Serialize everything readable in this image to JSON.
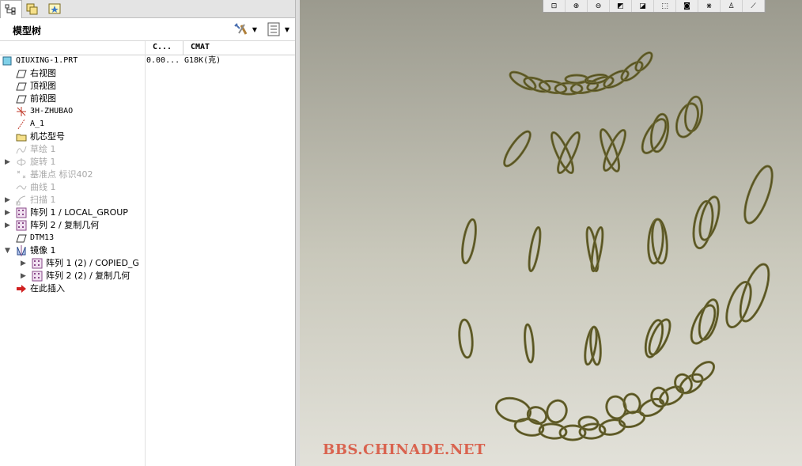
{
  "tree": {
    "title": "模型树",
    "columns": [
      "C...",
      "CMAT"
    ],
    "rows": [
      {
        "label": "QIUXING-1.PRT",
        "c": "0.00...",
        "cmat": "G18K(克)",
        "icon": "part-icon",
        "level": 0,
        "dim": false,
        "mono": true
      },
      {
        "label": "右视图",
        "icon": "datum-plane-icon",
        "level": 1,
        "dim": false
      },
      {
        "label": "顶视图",
        "icon": "datum-plane-icon",
        "level": 1,
        "dim": false
      },
      {
        "label": "前视图",
        "icon": "datum-plane-icon",
        "level": 1,
        "dim": false
      },
      {
        "label": "3H-ZHUBAO",
        "icon": "coordinate-system-icon",
        "level": 1,
        "dim": false,
        "mono": true
      },
      {
        "label": "A_1",
        "icon": "datum-axis-icon",
        "level": 1,
        "dim": false,
        "mono": true
      },
      {
        "label": "机芯型号",
        "icon": "folder-icon",
        "level": 1,
        "dim": false
      },
      {
        "label": "草绘 1",
        "icon": "sketch-icon",
        "level": 1,
        "dim": true
      },
      {
        "label": "旋转 1",
        "icon": "revolve-icon",
        "level": 1,
        "dim": true,
        "expand": true
      },
      {
        "label": "基准点 标识402",
        "icon": "datum-point-icon",
        "level": 1,
        "dim": true
      },
      {
        "label": "曲线 1",
        "icon": "curve-icon",
        "level": 1,
        "dim": true
      },
      {
        "label": "扫描 1",
        "icon": "sweep-icon",
        "level": 1,
        "dim": true,
        "expand": true
      },
      {
        "label": "阵列 1 / LOCAL_GROUP",
        "icon": "pattern-icon",
        "level": 1,
        "dim": false,
        "expand": true
      },
      {
        "label": "阵列 2 / 复制几何",
        "icon": "pattern-icon",
        "level": 1,
        "dim": false,
        "expand": true
      },
      {
        "label": "DTM13",
        "icon": "datum-plane-icon",
        "level": 1,
        "dim": false,
        "mono": true
      },
      {
        "label": "镜像 1",
        "icon": "mirror-icon",
        "level": 1,
        "dim": false,
        "expanded": true
      },
      {
        "label": "阵列 1 (2) / COPIED_G",
        "icon": "pattern-icon",
        "level": 2,
        "dim": false,
        "expand": true
      },
      {
        "label": "阵列 2 (2) / 复制几何",
        "icon": "pattern-icon",
        "level": 2,
        "dim": false,
        "expand": true
      },
      {
        "label": "在此插入",
        "icon": "insert-here-arrow-icon",
        "level": 1,
        "dim": false
      }
    ]
  },
  "viewport": {
    "watermark": "BBS.CHINADE.NET",
    "toolbar": [
      "zoom-fit-icon",
      "zoom-in-icon",
      "zoom-out-icon",
      "repaint-icon",
      "orient-icon",
      "saved-views-icon",
      "display-style-icon",
      "datum-display-icon",
      "annotation-icon",
      "spin-center-icon"
    ]
  },
  "colors": {
    "ring": "#6e6a32",
    "ring_dark": "#47431c",
    "watermark": "#d9634f"
  }
}
